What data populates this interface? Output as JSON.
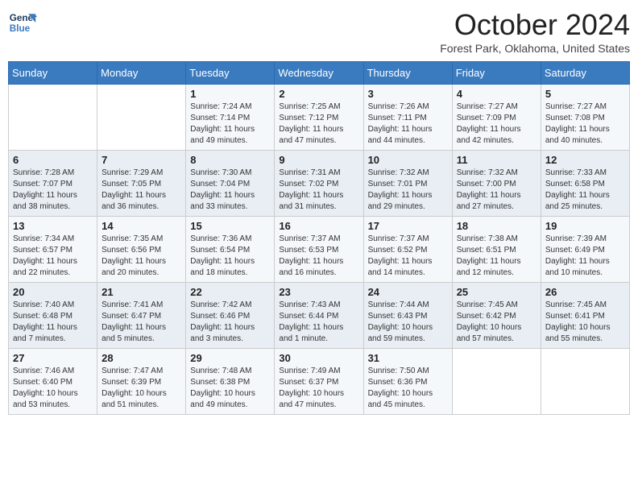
{
  "header": {
    "logo_line1": "General",
    "logo_line2": "Blue",
    "month": "October 2024",
    "location": "Forest Park, Oklahoma, United States"
  },
  "days_of_week": [
    "Sunday",
    "Monday",
    "Tuesday",
    "Wednesday",
    "Thursday",
    "Friday",
    "Saturday"
  ],
  "weeks": [
    [
      {
        "day": "",
        "text": ""
      },
      {
        "day": "",
        "text": ""
      },
      {
        "day": "1",
        "text": "Sunrise: 7:24 AM\nSunset: 7:14 PM\nDaylight: 11 hours and 49 minutes."
      },
      {
        "day": "2",
        "text": "Sunrise: 7:25 AM\nSunset: 7:12 PM\nDaylight: 11 hours and 47 minutes."
      },
      {
        "day": "3",
        "text": "Sunrise: 7:26 AM\nSunset: 7:11 PM\nDaylight: 11 hours and 44 minutes."
      },
      {
        "day": "4",
        "text": "Sunrise: 7:27 AM\nSunset: 7:09 PM\nDaylight: 11 hours and 42 minutes."
      },
      {
        "day": "5",
        "text": "Sunrise: 7:27 AM\nSunset: 7:08 PM\nDaylight: 11 hours and 40 minutes."
      }
    ],
    [
      {
        "day": "6",
        "text": "Sunrise: 7:28 AM\nSunset: 7:07 PM\nDaylight: 11 hours and 38 minutes."
      },
      {
        "day": "7",
        "text": "Sunrise: 7:29 AM\nSunset: 7:05 PM\nDaylight: 11 hours and 36 minutes."
      },
      {
        "day": "8",
        "text": "Sunrise: 7:30 AM\nSunset: 7:04 PM\nDaylight: 11 hours and 33 minutes."
      },
      {
        "day": "9",
        "text": "Sunrise: 7:31 AM\nSunset: 7:02 PM\nDaylight: 11 hours and 31 minutes."
      },
      {
        "day": "10",
        "text": "Sunrise: 7:32 AM\nSunset: 7:01 PM\nDaylight: 11 hours and 29 minutes."
      },
      {
        "day": "11",
        "text": "Sunrise: 7:32 AM\nSunset: 7:00 PM\nDaylight: 11 hours and 27 minutes."
      },
      {
        "day": "12",
        "text": "Sunrise: 7:33 AM\nSunset: 6:58 PM\nDaylight: 11 hours and 25 minutes."
      }
    ],
    [
      {
        "day": "13",
        "text": "Sunrise: 7:34 AM\nSunset: 6:57 PM\nDaylight: 11 hours and 22 minutes."
      },
      {
        "day": "14",
        "text": "Sunrise: 7:35 AM\nSunset: 6:56 PM\nDaylight: 11 hours and 20 minutes."
      },
      {
        "day": "15",
        "text": "Sunrise: 7:36 AM\nSunset: 6:54 PM\nDaylight: 11 hours and 18 minutes."
      },
      {
        "day": "16",
        "text": "Sunrise: 7:37 AM\nSunset: 6:53 PM\nDaylight: 11 hours and 16 minutes."
      },
      {
        "day": "17",
        "text": "Sunrise: 7:37 AM\nSunset: 6:52 PM\nDaylight: 11 hours and 14 minutes."
      },
      {
        "day": "18",
        "text": "Sunrise: 7:38 AM\nSunset: 6:51 PM\nDaylight: 11 hours and 12 minutes."
      },
      {
        "day": "19",
        "text": "Sunrise: 7:39 AM\nSunset: 6:49 PM\nDaylight: 11 hours and 10 minutes."
      }
    ],
    [
      {
        "day": "20",
        "text": "Sunrise: 7:40 AM\nSunset: 6:48 PM\nDaylight: 11 hours and 7 minutes."
      },
      {
        "day": "21",
        "text": "Sunrise: 7:41 AM\nSunset: 6:47 PM\nDaylight: 11 hours and 5 minutes."
      },
      {
        "day": "22",
        "text": "Sunrise: 7:42 AM\nSunset: 6:46 PM\nDaylight: 11 hours and 3 minutes."
      },
      {
        "day": "23",
        "text": "Sunrise: 7:43 AM\nSunset: 6:44 PM\nDaylight: 11 hours and 1 minute."
      },
      {
        "day": "24",
        "text": "Sunrise: 7:44 AM\nSunset: 6:43 PM\nDaylight: 10 hours and 59 minutes."
      },
      {
        "day": "25",
        "text": "Sunrise: 7:45 AM\nSunset: 6:42 PM\nDaylight: 10 hours and 57 minutes."
      },
      {
        "day": "26",
        "text": "Sunrise: 7:45 AM\nSunset: 6:41 PM\nDaylight: 10 hours and 55 minutes."
      }
    ],
    [
      {
        "day": "27",
        "text": "Sunrise: 7:46 AM\nSunset: 6:40 PM\nDaylight: 10 hours and 53 minutes."
      },
      {
        "day": "28",
        "text": "Sunrise: 7:47 AM\nSunset: 6:39 PM\nDaylight: 10 hours and 51 minutes."
      },
      {
        "day": "29",
        "text": "Sunrise: 7:48 AM\nSunset: 6:38 PM\nDaylight: 10 hours and 49 minutes."
      },
      {
        "day": "30",
        "text": "Sunrise: 7:49 AM\nSunset: 6:37 PM\nDaylight: 10 hours and 47 minutes."
      },
      {
        "day": "31",
        "text": "Sunrise: 7:50 AM\nSunset: 6:36 PM\nDaylight: 10 hours and 45 minutes."
      },
      {
        "day": "",
        "text": ""
      },
      {
        "day": "",
        "text": ""
      }
    ]
  ]
}
